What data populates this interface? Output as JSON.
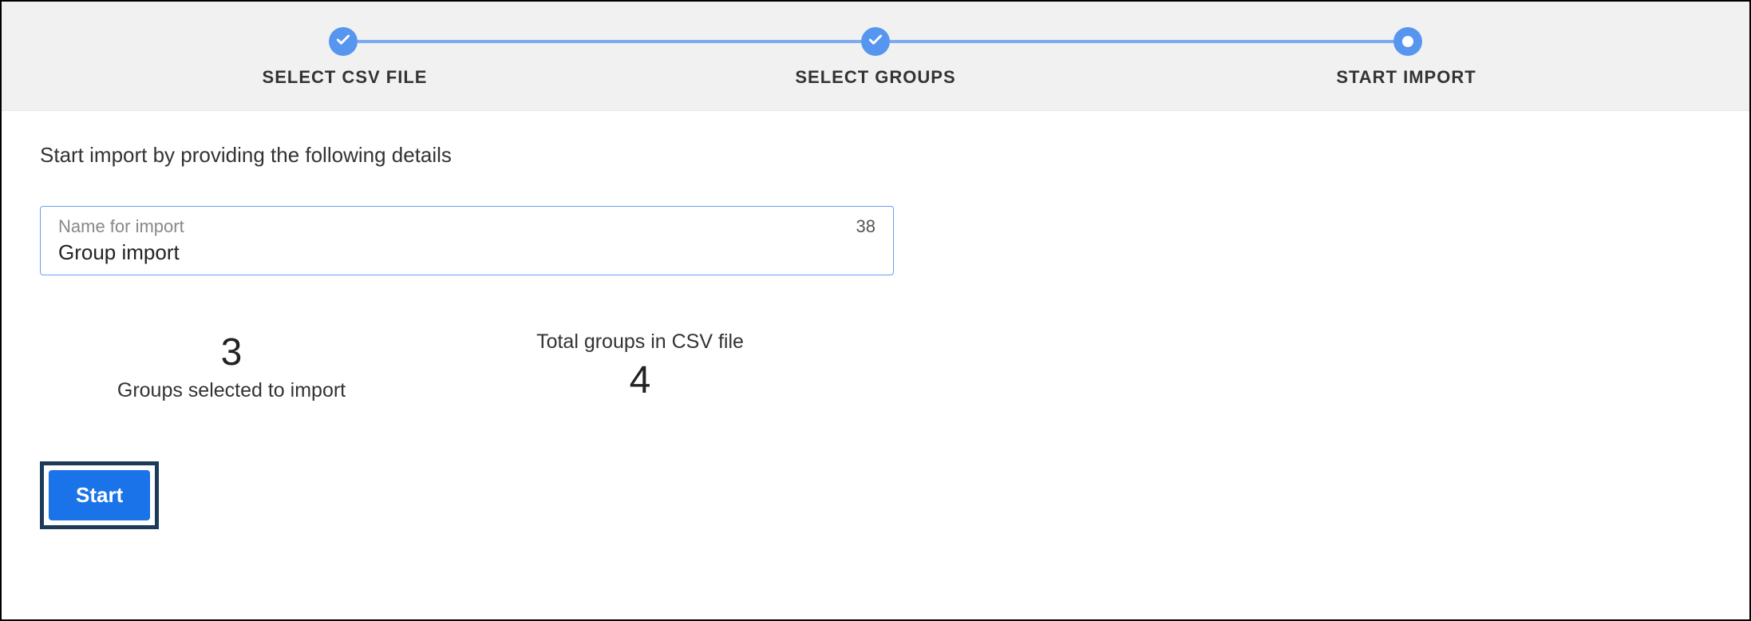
{
  "stepper": {
    "steps": [
      {
        "label": "SELECT CSV FILE",
        "state": "done"
      },
      {
        "label": "SELECT GROUPS",
        "state": "done"
      },
      {
        "label": "START IMPORT",
        "state": "current"
      }
    ]
  },
  "content": {
    "intro": "Start import by providing the following details",
    "name_input": {
      "label": "Name for import",
      "value": "Group import",
      "counter": "38"
    },
    "cards": {
      "selected": {
        "value": "3",
        "label": "Groups selected to import"
      },
      "total": {
        "value": "4",
        "label": "Total groups in CSV file"
      }
    },
    "start_button": "Start"
  },
  "colors": {
    "accent": "#5796ef",
    "primary_button": "#1a73e8",
    "highlight_border": "#1b3b57"
  }
}
